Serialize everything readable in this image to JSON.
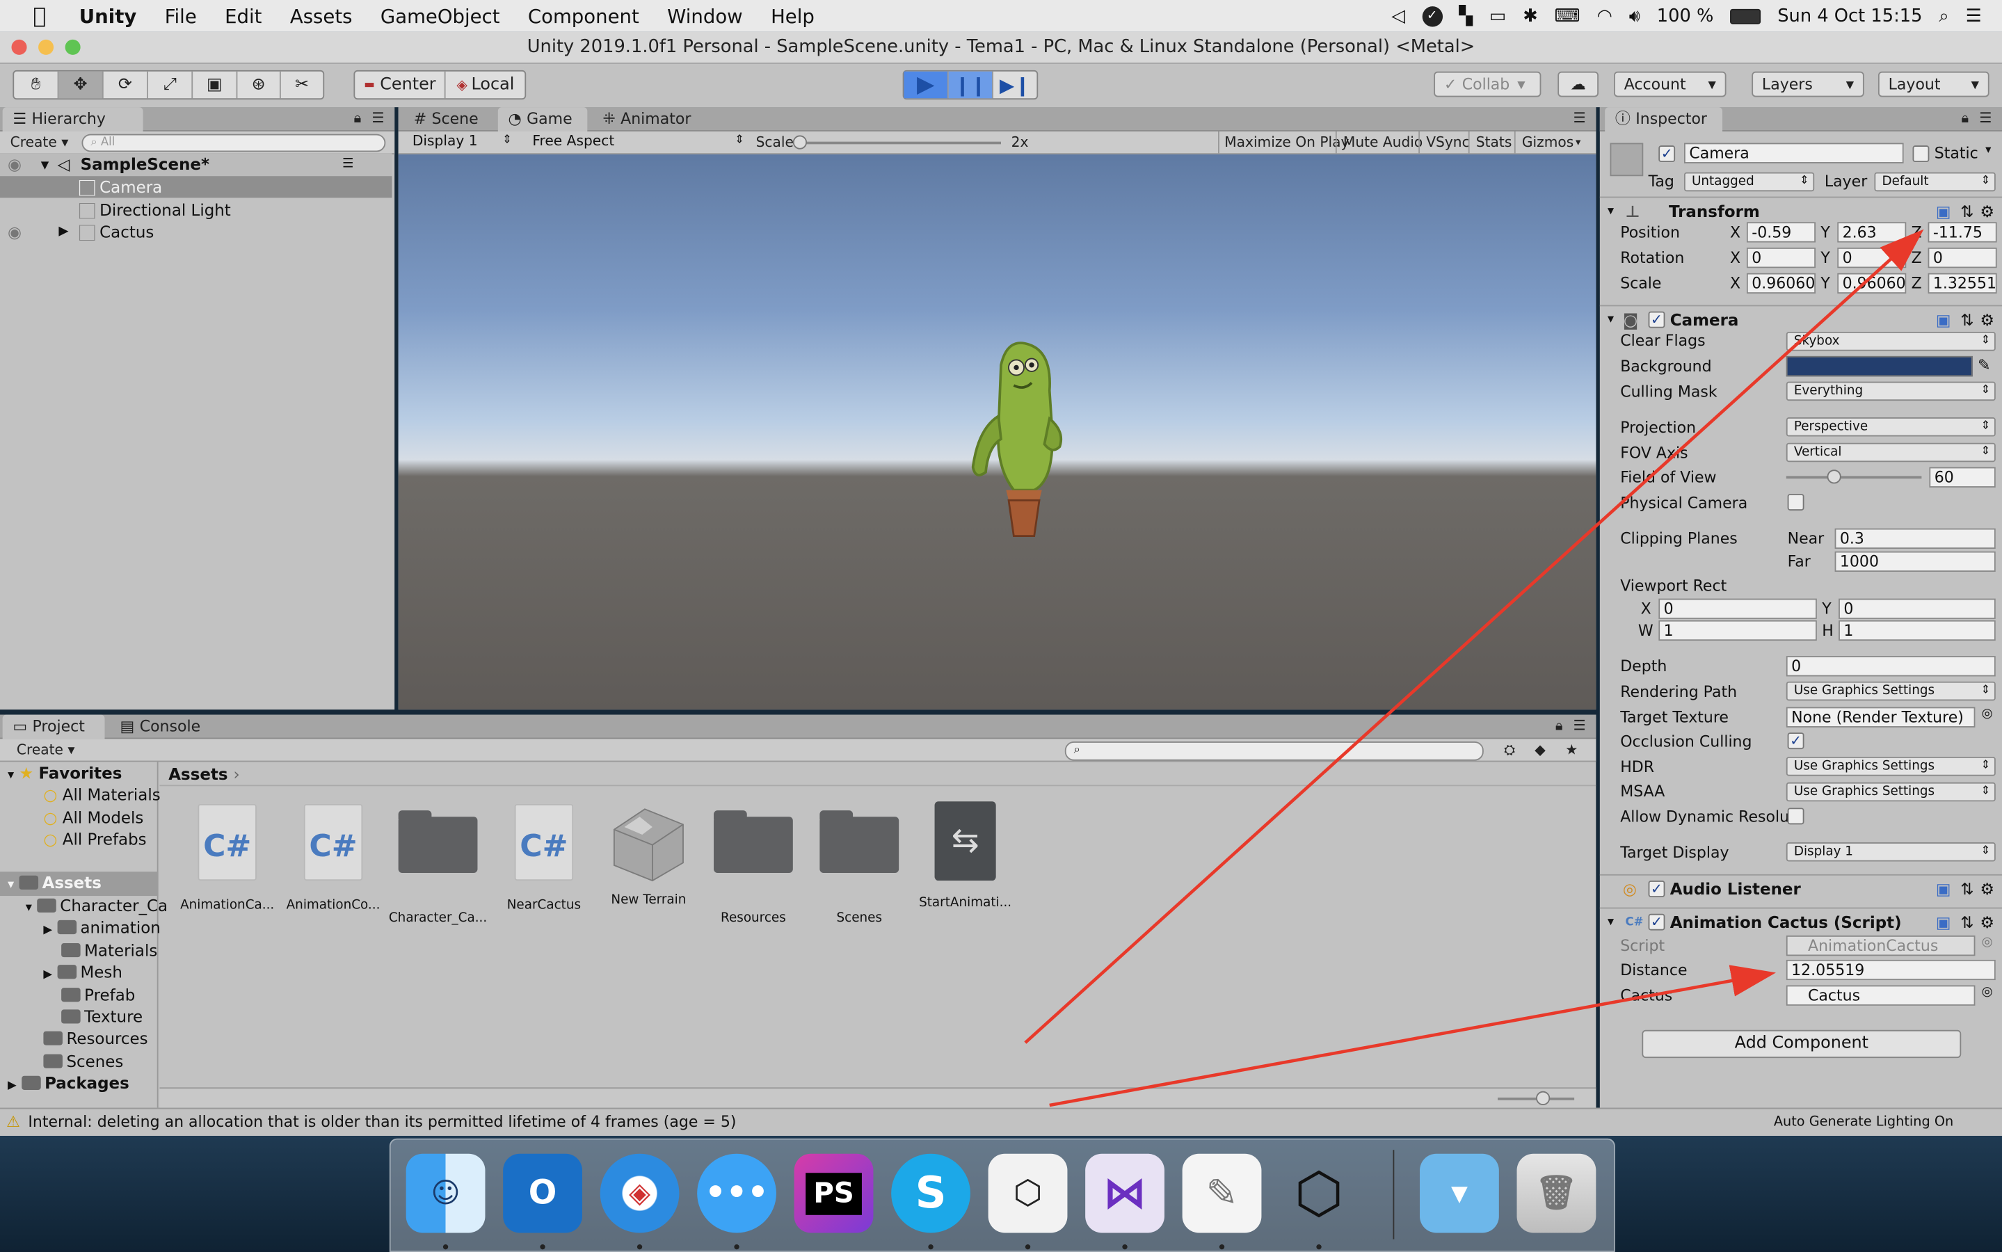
{
  "menubar": {
    "app": "Unity",
    "items": [
      "File",
      "Edit",
      "Assets",
      "GameObject",
      "Component",
      "Window",
      "Help"
    ],
    "battery": "100 %",
    "clock": "Sun 4 Oct  15:15"
  },
  "window_title": "Unity 2019.1.0f1 Personal - SampleScene.unity - Tema1 - PC, Mac & Linux Standalone (Personal) <Metal>",
  "toolbar": {
    "pivot": "Center",
    "space": "Local",
    "collab": "Collab",
    "account": "Account",
    "layers": "Layers",
    "layout": "Layout"
  },
  "hierarchy": {
    "tab": "Hierarchy",
    "create": "Create",
    "search_placeholder": "All",
    "scene": "SampleScene*",
    "items": [
      "Camera",
      "Directional Light",
      "Cactus"
    ]
  },
  "view": {
    "tabs": [
      "Scene",
      "Game",
      "Animator"
    ],
    "display": "Display 1",
    "aspect": "Free Aspect",
    "scale_label": "Scale",
    "scale_value": "2x",
    "buttons": [
      "Maximize On Play",
      "Mute Audio",
      "VSync",
      "Stats",
      "Gizmos"
    ]
  },
  "project": {
    "tabs": [
      "Project",
      "Console"
    ],
    "create": "Create",
    "favorites": "Favorites",
    "favorite_items": [
      "All Materials",
      "All Models",
      "All Prefabs"
    ],
    "assets_root": "Assets",
    "tree": [
      "Character_Ca",
      "animation",
      "Materials",
      "Mesh",
      "Prefab",
      "Texture",
      "Resources",
      "Scenes"
    ],
    "packages": "Packages",
    "breadcrumb": "Assets",
    "assets": [
      {
        "name": "AnimationCa...",
        "kind": "cs"
      },
      {
        "name": "AnimationCo...",
        "kind": "cs"
      },
      {
        "name": "Character_Ca...",
        "kind": "folder"
      },
      {
        "name": "NearCactus",
        "kind": "cs"
      },
      {
        "name": "New Terrain",
        "kind": "terrain"
      },
      {
        "name": "Resources",
        "kind": "folder"
      },
      {
        "name": "Scenes",
        "kind": "folder"
      },
      {
        "name": "StartAnimati...",
        "kind": "anim"
      }
    ]
  },
  "inspector": {
    "tab": "Inspector",
    "object_name": "Camera",
    "static_label": "Static",
    "tag_label": "Tag",
    "tag_value": "Untagged",
    "layer_label": "Layer",
    "layer_value": "Default",
    "transform": {
      "title": "Transform",
      "position_label": "Position",
      "position": [
        "-0.59",
        "2.63",
        "-11.75"
      ],
      "rotation_label": "Rotation",
      "rotation": [
        "0",
        "0",
        "0"
      ],
      "scale_label": "Scale",
      "scale": [
        "0.96060",
        "0.96060",
        "1.32551"
      ]
    },
    "camera": {
      "title": "Camera",
      "clear_flags_label": "Clear Flags",
      "clear_flags": "Skybox",
      "background_label": "Background",
      "culling_mask_label": "Culling Mask",
      "culling_mask": "Everything",
      "projection_label": "Projection",
      "projection": "Perspective",
      "fov_axis_label": "FOV Axis",
      "fov_axis": "Vertical",
      "fov_label": "Field of View",
      "fov": "60",
      "physical_label": "Physical Camera",
      "clipping_label": "Clipping Planes",
      "near_label": "Near",
      "near": "0.3",
      "far_label": "Far",
      "far": "1000",
      "viewport_label": "Viewport Rect",
      "vx": "0",
      "vy": "0",
      "vw": "1",
      "vh": "1",
      "depth_label": "Depth",
      "depth": "0",
      "rendering_path_label": "Rendering Path",
      "rendering_path": "Use Graphics Settings",
      "target_texture_label": "Target Texture",
      "target_texture": "None (Render Texture)",
      "occlusion_label": "Occlusion Culling",
      "hdr_label": "HDR",
      "hdr": "Use Graphics Settings",
      "msaa_label": "MSAA",
      "msaa": "Use Graphics Settings",
      "dynamic_res_label": "Allow Dynamic Resolut",
      "target_display_label": "Target Display",
      "target_display": "Display 1"
    },
    "audio_listener": "Audio Listener",
    "script_component": {
      "title": "Animation Cactus (Script)",
      "script_label": "Script",
      "script": "AnimationCactus",
      "distance_label": "Distance",
      "distance": "12.05519",
      "cactus_label": "Cactus",
      "cactus": "Cactus"
    },
    "add_component": "Add Component"
  },
  "status": {
    "message": "Internal: deleting an allocation that is older than its permitted lifetime of 4 frames (age = 5)",
    "right": "Auto Generate Lighting On"
  },
  "colors": {
    "annotation_arrow": "#e8392a",
    "camera_background": "#233e6e",
    "accent": "#3b74d6"
  },
  "dock": {
    "icons": [
      "finder-icon",
      "outlook-icon",
      "safari-icon",
      "messages-icon",
      "phpstorm-icon",
      "skype-icon",
      "unity-hub-icon",
      "visual-studio-icon",
      "textedit-icon",
      "unity-icon",
      "downloads-folder-icon",
      "trash-icon"
    ],
    "glyphs": {
      "outlook": "O",
      "phpstorm": "PS",
      "skype": "S"
    }
  }
}
